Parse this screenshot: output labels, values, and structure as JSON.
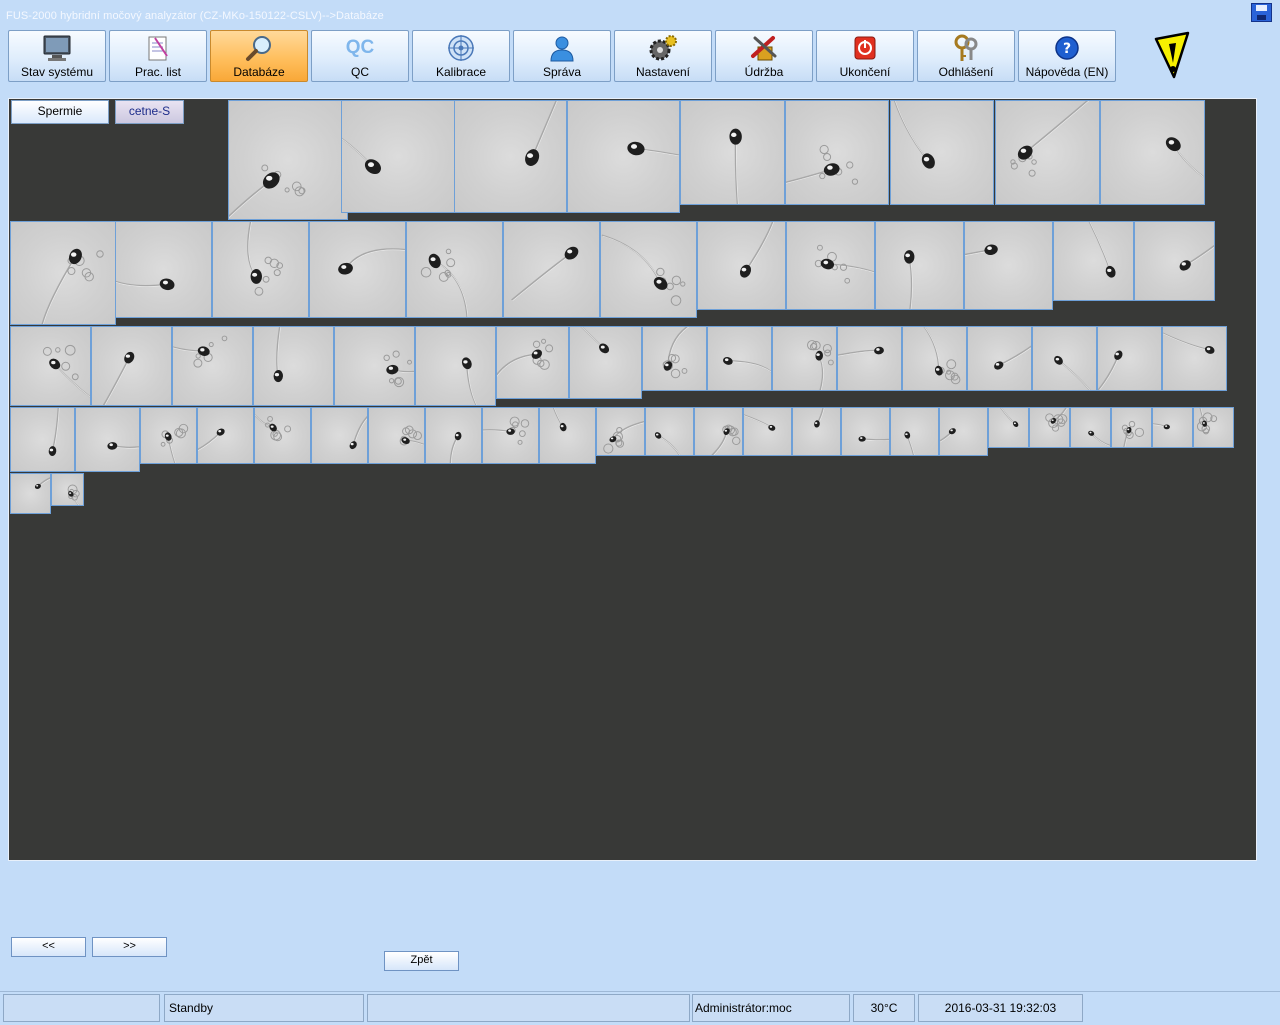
{
  "window": {
    "title": "FUS-2000 hybridní močový analyzátor (CZ-MKo-150122-CSLV)-->Databáze"
  },
  "toolbar": {
    "buttons": [
      {
        "label": "Stav systému",
        "icon": "monitor-icon",
        "active": false
      },
      {
        "label": "Prac. list",
        "icon": "worklist-icon",
        "active": false
      },
      {
        "label": "Databáze",
        "icon": "magnifier-icon",
        "active": true
      },
      {
        "label": "QC",
        "icon": "qc-icon",
        "active": false
      },
      {
        "label": "Kalibrace",
        "icon": "target-icon",
        "active": false
      },
      {
        "label": "Správa",
        "icon": "user-icon",
        "active": false
      },
      {
        "label": "Nastavení",
        "icon": "gear-icon",
        "active": false
      },
      {
        "label": "Údržba",
        "icon": "tools-icon",
        "active": false
      },
      {
        "label": "Ukončení",
        "icon": "power-icon",
        "active": false
      },
      {
        "label": "Odhlášení",
        "icon": "keys-icon",
        "active": false
      },
      {
        "label": "Nápověda (EN)",
        "icon": "help-icon",
        "active": false
      }
    ],
    "qc_icon_text": "QC"
  },
  "tabs": {
    "active": "Spermie",
    "inactive": "cetne-S"
  },
  "gallery": {
    "thumbnail_count": 80
  },
  "navigation": {
    "prev_label": "<<",
    "next_label": ">>",
    "back_label": "Zpět"
  },
  "status_bar": {
    "cell1": "",
    "state": "Standby",
    "cell3": "",
    "user": "Administrátor:moc",
    "temperature": "30°C",
    "datetime": "2016-03-31 19:32:03"
  }
}
